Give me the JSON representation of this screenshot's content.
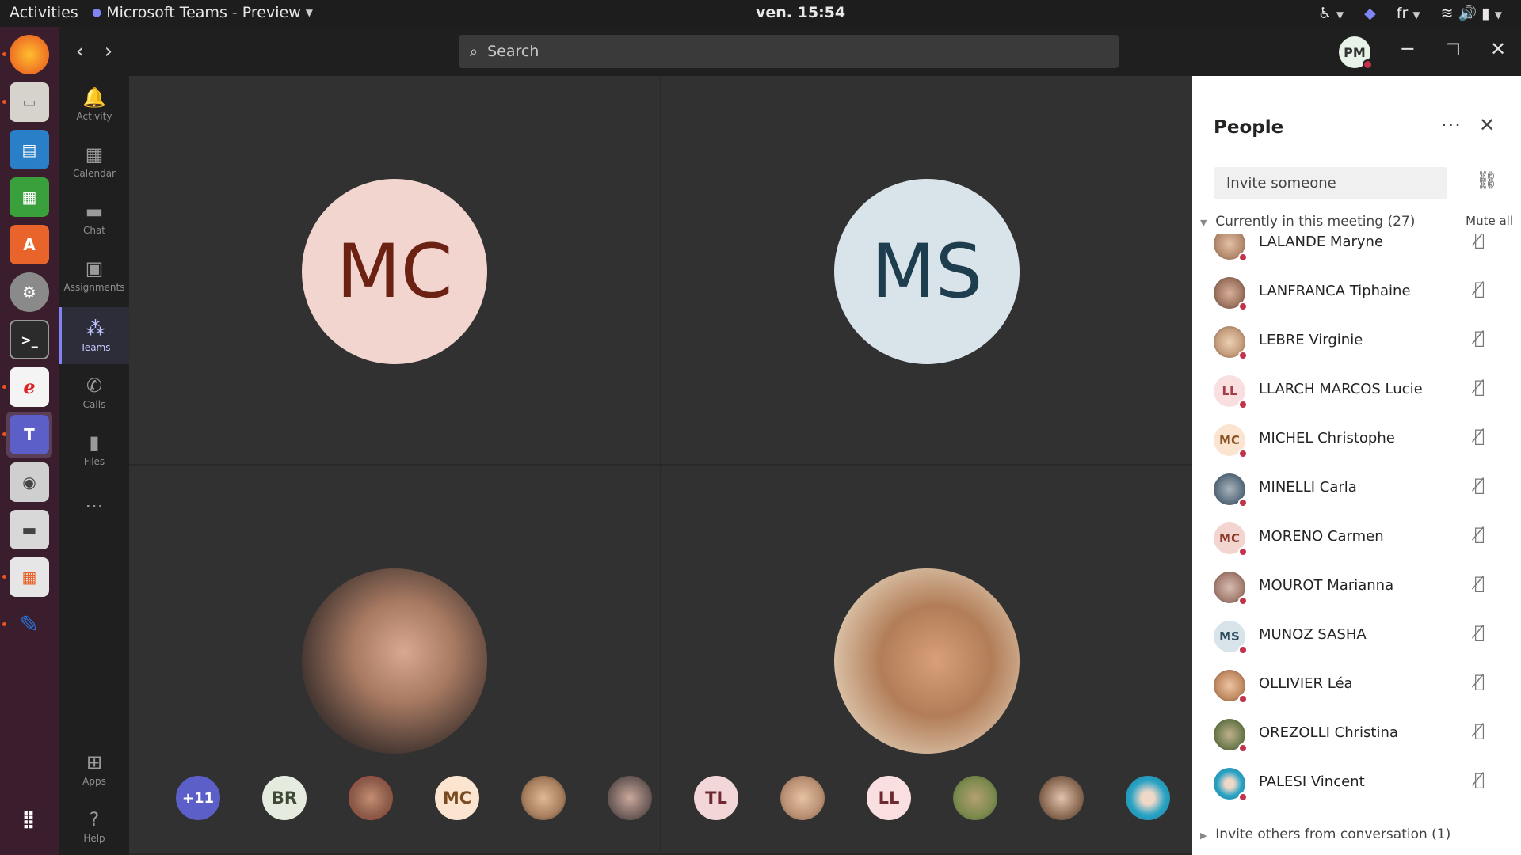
{
  "topbar": {
    "activities": "Activities",
    "app_name": "Microsoft Teams - Preview",
    "clock": "ven. 15:54",
    "lang": "fr"
  },
  "teams": {
    "search_placeholder": "Search",
    "me_initials": "PM",
    "rail": [
      {
        "label": "Activity",
        "icon": "bell-icon",
        "glyph": "🔔"
      },
      {
        "label": "Calendar",
        "icon": "calendar-icon",
        "glyph": "▦"
      },
      {
        "label": "Chat",
        "icon": "chat-icon",
        "glyph": "▬"
      },
      {
        "label": "Assignments",
        "icon": "assignments-icon",
        "glyph": "▣"
      },
      {
        "label": "Teams",
        "icon": "teams-icon",
        "glyph": "⁂"
      },
      {
        "label": "Calls",
        "icon": "phone-icon",
        "glyph": "✆"
      },
      {
        "label": "Files",
        "icon": "file-icon",
        "glyph": "▮"
      },
      {
        "label": "",
        "icon": "more-icon",
        "glyph": "···"
      },
      {
        "label": "Apps",
        "icon": "apps-icon",
        "glyph": "⊞"
      },
      {
        "label": "Help",
        "icon": "help-icon",
        "glyph": "?"
      }
    ]
  },
  "stage": {
    "tiles": [
      {
        "initials": "MC",
        "bg": "#f3d5cf",
        "fg": "#6b2212"
      },
      {
        "initials": "MS",
        "bg": "#d8e4ea",
        "fg": "#1e3d4e"
      },
      {
        "photo": "participant-photo-1"
      },
      {
        "photo": "participant-photo-2"
      }
    ],
    "strip": [
      {
        "text": "+11",
        "bg": "#5b5fc7",
        "fg": "#ffffff"
      },
      {
        "text": "BR",
        "bg": "#e5ecdf",
        "fg": "#3f4a36"
      },
      {
        "text": "",
        "bg": "#8a5a48",
        "fg": "#fff"
      },
      {
        "text": "MC",
        "bg": "#fbe5d1",
        "fg": "#7a4b20"
      },
      {
        "text": "",
        "bg": "#a77f5e",
        "fg": "#fff"
      },
      {
        "text": "",
        "bg": "#6a5a57",
        "fg": "#fff"
      },
      {
        "text": "TL",
        "bg": "#f2d6d8",
        "fg": "#6e2a30"
      },
      {
        "text": "",
        "bg": "#b99073",
        "fg": "#fff"
      },
      {
        "text": "LL",
        "bg": "#fadfe1",
        "fg": "#6e2a30"
      },
      {
        "text": "",
        "bg": "#7b8a4e",
        "fg": "#fff"
      },
      {
        "text": "",
        "bg": "#8c6b55",
        "fg": "#fff"
      },
      {
        "text": "",
        "bg": "#2aa3c4",
        "fg": "#fff"
      }
    ]
  },
  "people": {
    "title": "People",
    "invite_placeholder": "Invite someone",
    "section_label": "Currently in this meeting (27)",
    "mute_all": "Mute all",
    "footer": "Invite others from conversation (1)",
    "list": [
      {
        "name": "LALANDE Maryne",
        "initials": "",
        "bg": "#b58a6e",
        "fg": "#fff"
      },
      {
        "name": "LANFRANCA Tiphaine",
        "initials": "",
        "bg": "#9c7460",
        "fg": "#fff"
      },
      {
        "name": "LEBRE Virginie",
        "initials": "",
        "bg": "#c39b7a",
        "fg": "#fff"
      },
      {
        "name": "LLARCH MARCOS Lucie",
        "initials": "LL",
        "bg": "#fadfe1",
        "fg": "#a33d4a"
      },
      {
        "name": "MICHEL Christophe",
        "initials": "MC",
        "bg": "#fbe5d1",
        "fg": "#8a5424"
      },
      {
        "name": "MINELLI Carla",
        "initials": "",
        "bg": "#5d7080",
        "fg": "#fff"
      },
      {
        "name": "MORENO Carmen",
        "initials": "MC",
        "bg": "#f3d5cf",
        "fg": "#8b3a2a"
      },
      {
        "name": "MOUROT Marianna",
        "initials": "",
        "bg": "#a47f72",
        "fg": "#fff"
      },
      {
        "name": "MUNOZ SASHA",
        "initials": "MS",
        "bg": "#d8e4ea",
        "fg": "#2c4d5e"
      },
      {
        "name": "OLLIVIER Léa",
        "initials": "",
        "bg": "#c08a62",
        "fg": "#fff"
      },
      {
        "name": "OREZOLLI Christina",
        "initials": "",
        "bg": "#6f7c4f",
        "fg": "#fff"
      },
      {
        "name": "PALESI Vincent",
        "initials": "",
        "bg": "#2aa3c4",
        "fg": "#fff"
      }
    ]
  }
}
